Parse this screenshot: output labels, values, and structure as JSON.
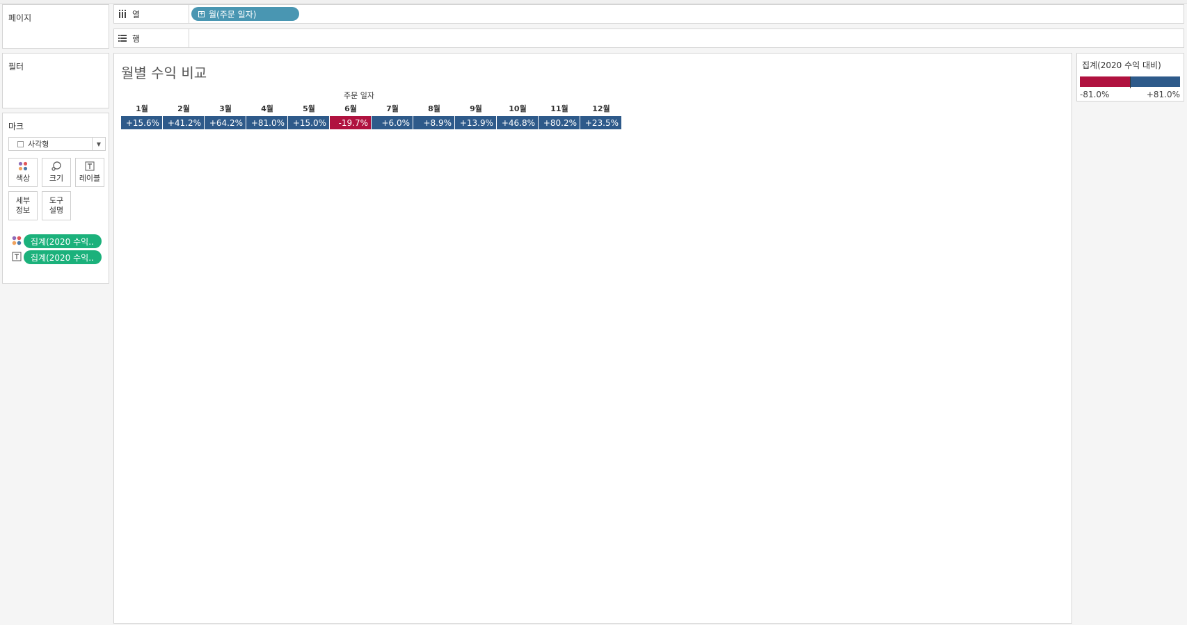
{
  "panels": {
    "pages": "페이지",
    "filters": "필터",
    "marks": "마크"
  },
  "shelves": {
    "columns": {
      "label": "열",
      "icon": "columns-icon",
      "pill": "월(주문 일자)"
    },
    "rows": {
      "label": "행",
      "icon": "rows-icon"
    }
  },
  "marks": {
    "type": "사각형",
    "buttons": {
      "color": "색상",
      "size": "크기",
      "label": "레이블",
      "detail": "세부 정보",
      "detail_line1": "세부",
      "detail_line2": "정보",
      "tooltip": "도구 설명",
      "tooltip_line1": "도구",
      "tooltip_line2": "설명"
    },
    "fields": [
      {
        "icon": "color-dots-icon",
        "label": "집계(2020 수익.."
      },
      {
        "icon": "text-label-icon",
        "label": "집계(2020 수익.."
      }
    ]
  },
  "view": {
    "title": "월별 수익 비교",
    "axis_title": "주문 일자"
  },
  "colors": {
    "positive": "#2e5a8a",
    "negative": "#b0123f",
    "pill_blue": "#4996b2",
    "pill_green": "#1bb17b"
  },
  "chart_data": {
    "type": "heatmap",
    "title": "월별 수익 비교",
    "xlabel": "주문 일자",
    "categories": [
      "1월",
      "2월",
      "3월",
      "4월",
      "5월",
      "6월",
      "7월",
      "8월",
      "9월",
      "10월",
      "11월",
      "12월"
    ],
    "values": [
      15.6,
      41.2,
      64.2,
      81.0,
      15.0,
      -19.7,
      6.0,
      8.9,
      13.9,
      46.8,
      80.2,
      23.5
    ],
    "labels": [
      "+15.6%",
      "+41.2%",
      "+64.2%",
      "+81.0%",
      "+15.0%",
      "-19.7%",
      "+6.0%",
      "+8.9%",
      "+13.9%",
      "+46.8%",
      "+80.2%",
      "+23.5%"
    ],
    "color_range": [
      -81.0,
      81.0
    ]
  },
  "legend": {
    "title": "집계(2020 수익 대비)",
    "min_label": "-81.0%",
    "max_label": "+81.0%"
  }
}
